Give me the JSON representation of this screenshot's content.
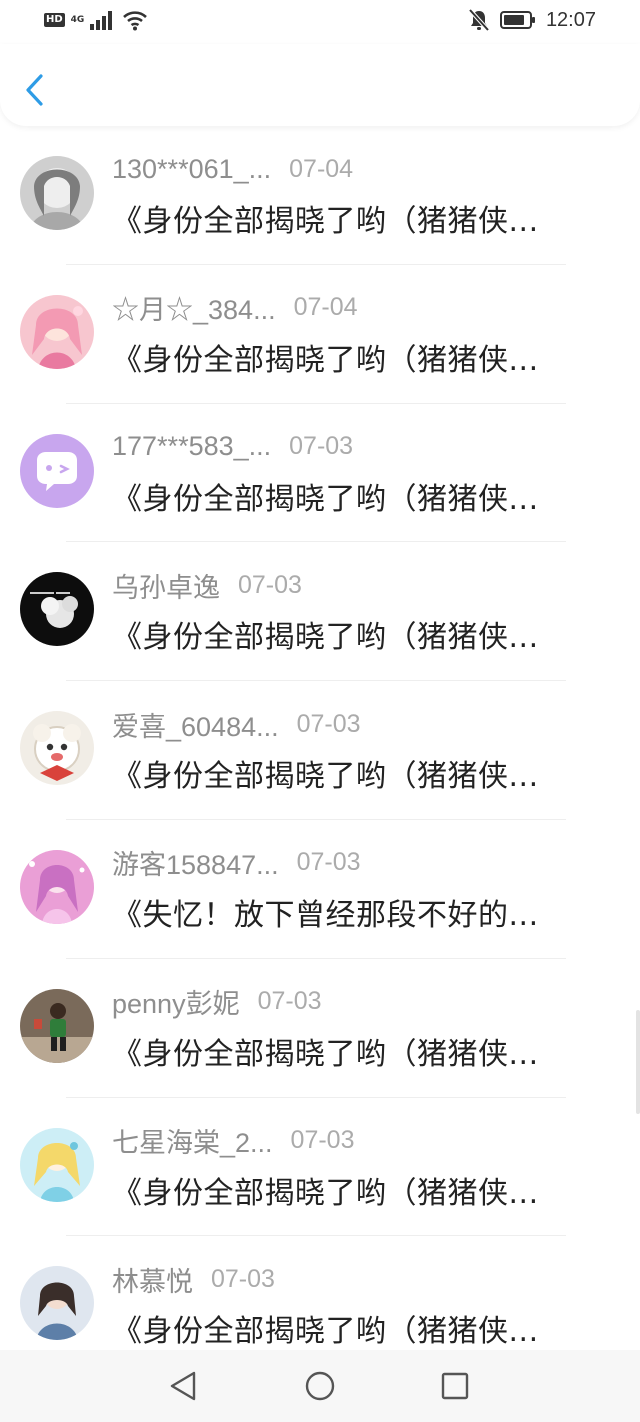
{
  "status_bar": {
    "hd_label": "HD",
    "network_label": "4G",
    "time": "12:07",
    "icons": [
      "signal-icon",
      "wifi-icon",
      "mute-bell-icon",
      "battery-icon"
    ]
  },
  "top_bar": {
    "back_icon": "chevron-left-icon",
    "accent_color": "#2e9ce6"
  },
  "messages": [
    {
      "user": "130***061_...",
      "date": "07-04",
      "text": "《身份全部揭晓了哟（猪猪侠..."
    },
    {
      "user": "☆月☆_384...",
      "date": "07-04",
      "text": "《身份全部揭晓了哟（猪猪侠..."
    },
    {
      "user": "177***583_...",
      "date": "07-03",
      "text": "《身份全部揭晓了哟（猪猪侠..."
    },
    {
      "user": "乌孙卓逸",
      "date": "07-03",
      "text": "《身份全部揭晓了哟（猪猪侠..."
    },
    {
      "user": "爱喜_60484...",
      "date": "07-03",
      "text": "《身份全部揭晓了哟（猪猪侠..."
    },
    {
      "user": "游客158847...",
      "date": "07-03",
      "text": "《失忆！放下曾经那段不好的..."
    },
    {
      "user": "penny彭妮",
      "date": "07-03",
      "text": "《身份全部揭晓了哟（猪猪侠..."
    },
    {
      "user": "七星海棠_2...",
      "date": "07-03",
      "text": "《身份全部揭晓了哟（猪猪侠..."
    },
    {
      "user": "林慕悦",
      "date": "07-03",
      "text": "《身份全部揭晓了哟（猪猪侠..."
    }
  ],
  "nav_bar": {
    "icons": [
      "back-triangle-icon",
      "home-circle-icon",
      "recents-square-icon"
    ]
  }
}
